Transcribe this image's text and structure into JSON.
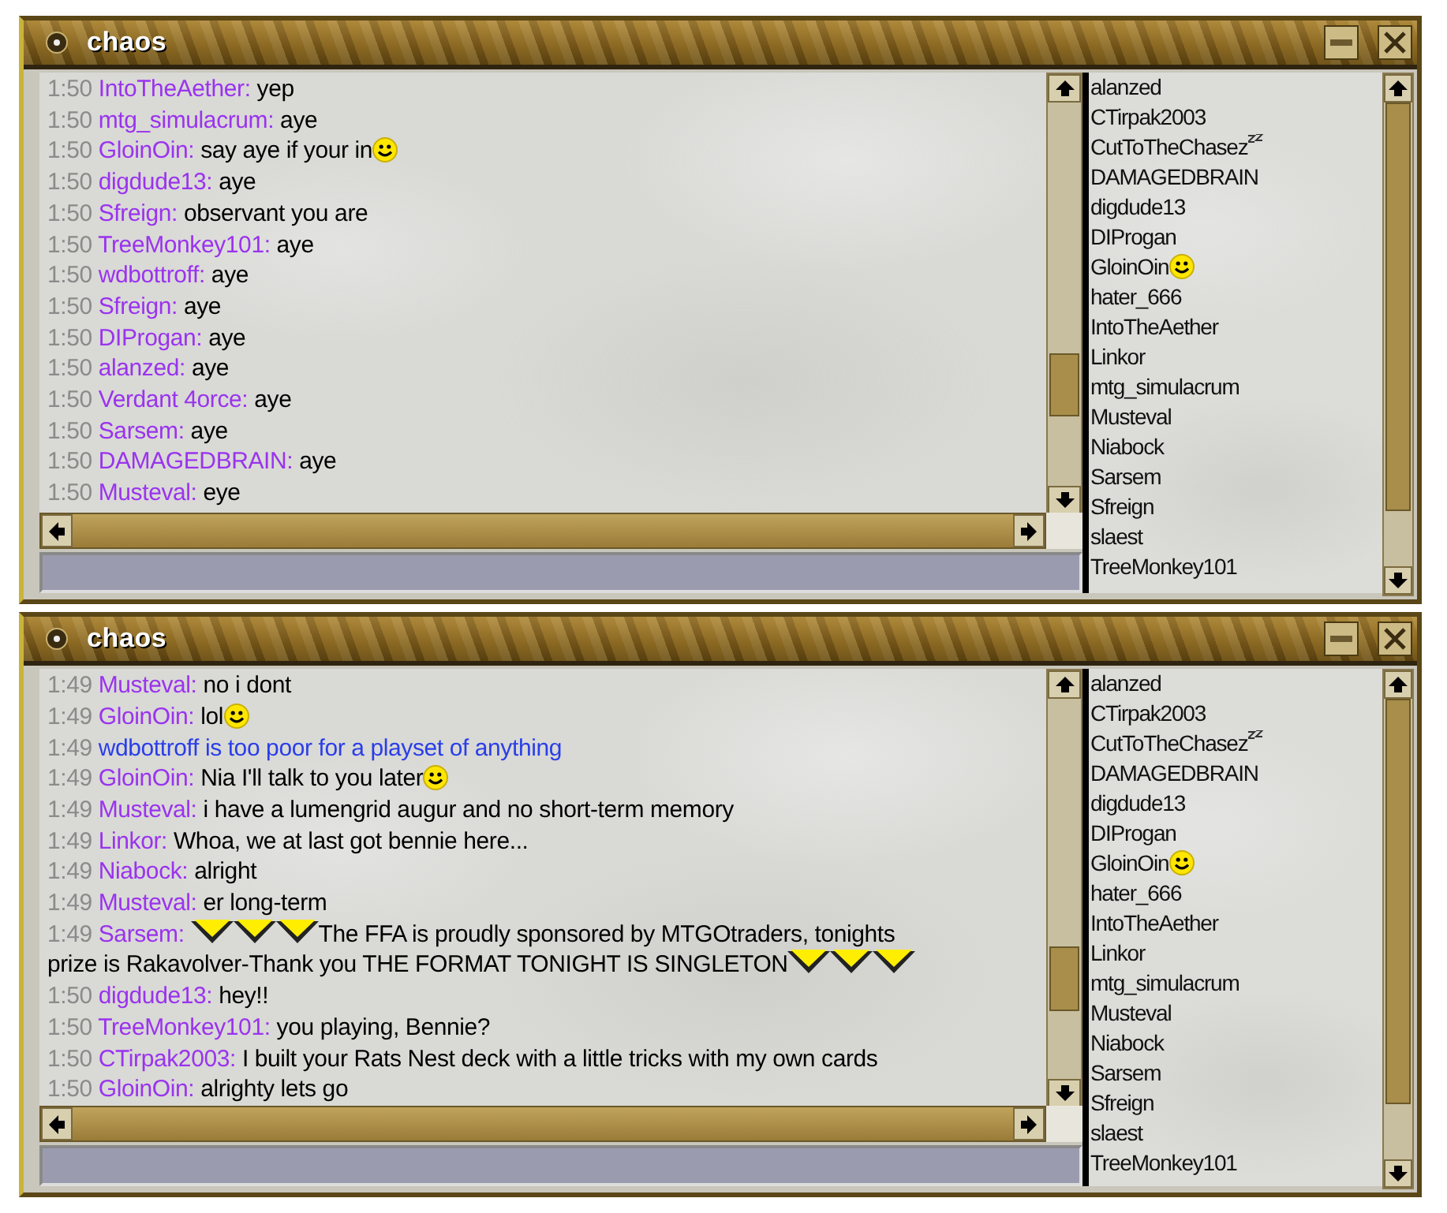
{
  "windows": [
    {
      "title": "chaos",
      "messages": [
        {
          "kind": "chat",
          "time": "1:50",
          "user": "IntoTheAether:",
          "text": "yep"
        },
        {
          "kind": "chat",
          "time": "1:50",
          "user": "mtg_simulacrum:",
          "text": "aye"
        },
        {
          "kind": "chat",
          "time": "1:50",
          "user": "GloinOin:",
          "text": "say aye if your in",
          "icons_after": [
            {
              "kind": "smiley"
            }
          ]
        },
        {
          "kind": "chat",
          "time": "1:50",
          "user": "digdude13:",
          "text": "aye"
        },
        {
          "kind": "chat",
          "time": "1:50",
          "user": "Sfreign:",
          "text": "observant you are"
        },
        {
          "kind": "chat",
          "time": "1:50",
          "user": "TreeMonkey101:",
          "text": "aye"
        },
        {
          "kind": "chat",
          "time": "1:50",
          "user": "wdbottroff:",
          "text": "aye"
        },
        {
          "kind": "chat",
          "time": "1:50",
          "user": "Sfreign:",
          "text": "aye"
        },
        {
          "kind": "chat",
          "time": "1:50",
          "user": "DIProgan:",
          "text": "aye"
        },
        {
          "kind": "chat",
          "time": "1:50",
          "user": "alanzed:",
          "text": "aye"
        },
        {
          "kind": "chat",
          "time": "1:50",
          "user": "Verdant 4orce:",
          "text": "aye"
        },
        {
          "kind": "chat",
          "time": "1:50",
          "user": "Sarsem:",
          "text": "aye"
        },
        {
          "kind": "chat",
          "time": "1:50",
          "user": "DAMAGEDBRAIN:",
          "text": "aye"
        },
        {
          "kind": "chat",
          "time": "1:50",
          "user": "Musteval:",
          "text": "eye"
        }
      ],
      "users": [
        {
          "name": "alanzed"
        },
        {
          "name": "CTirpak2003"
        },
        {
          "name": "CutToTheChasez",
          "away": true
        },
        {
          "name": "DAMAGEDBRAIN"
        },
        {
          "name": "digdude13"
        },
        {
          "name": "DIProgan"
        },
        {
          "name": "GloinOin",
          "icons": [
            {
              "kind": "smiley"
            }
          ]
        },
        {
          "name": "hater_666"
        },
        {
          "name": "IntoTheAether"
        },
        {
          "name": "Linkor"
        },
        {
          "name": "mtg_simulacrum"
        },
        {
          "name": "Musteval"
        },
        {
          "name": "Niabock"
        },
        {
          "name": "Sarsem"
        },
        {
          "name": "Sfreign"
        },
        {
          "name": "slaest"
        },
        {
          "name": "TreeMonkey101"
        }
      ]
    },
    {
      "title": "chaos",
      "messages": [
        {
          "kind": "chat",
          "time": "1:49",
          "user": "Musteval:",
          "text": "no i dont"
        },
        {
          "kind": "chat",
          "time": "1:49",
          "user": "GloinOin:",
          "text": "lol",
          "icons_after": [
            {
              "kind": "smiley"
            }
          ]
        },
        {
          "kind": "emote",
          "time": "1:49",
          "text": "wdbottroff is too poor for a playset of anything"
        },
        {
          "kind": "chat",
          "time": "1:49",
          "user": "GloinOin:",
          "text": "Nia I'll talk to you later",
          "icons_after": [
            {
              "kind": "smiley"
            }
          ]
        },
        {
          "kind": "chat",
          "time": "1:49",
          "user": "Musteval:",
          "text": "i have a lumengrid augur and no short-term memory"
        },
        {
          "kind": "chat",
          "time": "1:49",
          "user": "Linkor:",
          "text": "Whoa, we at last got bennie here..."
        },
        {
          "kind": "chat",
          "time": "1:49",
          "user": "Niabock:",
          "text": "alright"
        },
        {
          "kind": "chat",
          "time": "1:49",
          "user": "Musteval:",
          "text": "er long-term"
        },
        {
          "kind": "chat",
          "time": "1:49",
          "user": "Sarsem:",
          "text": "The FFA is proudly sponsored by MTGOtraders, tonights",
          "text_line_2": "prize is Rakavolver-Thank you THE FORMAT TONIGHT IS SINGLETON",
          "icons_before": [
            {
              "kind": "chevron"
            },
            {
              "kind": "chevron"
            },
            {
              "kind": "chevron"
            }
          ],
          "icons_after": [
            {
              "kind": "chevron"
            },
            {
              "kind": "chevron"
            },
            {
              "kind": "chevron"
            }
          ]
        },
        {
          "kind": "chat",
          "time": "1:50",
          "user": "digdude13:",
          "text": "hey!!"
        },
        {
          "kind": "chat",
          "time": "1:50",
          "user": "TreeMonkey101:",
          "text": "you playing, Bennie?"
        },
        {
          "kind": "chat",
          "time": "1:50",
          "user": "CTirpak2003:",
          "text": "I built your Rats Nest deck with a little tricks with my own cards"
        },
        {
          "kind": "chat",
          "time": "1:50",
          "user": "GloinOin:",
          "text": "alrighty lets go"
        }
      ],
      "users": [
        {
          "name": "alanzed"
        },
        {
          "name": "CTirpak2003"
        },
        {
          "name": "CutToTheChasez",
          "away": true
        },
        {
          "name": "DAMAGEDBRAIN"
        },
        {
          "name": "digdude13"
        },
        {
          "name": "DIProgan"
        },
        {
          "name": "GloinOin",
          "icons": [
            {
              "kind": "smiley"
            }
          ]
        },
        {
          "name": "hater_666"
        },
        {
          "name": "IntoTheAether"
        },
        {
          "name": "Linkor"
        },
        {
          "name": "mtg_simulacrum"
        },
        {
          "name": "Musteval"
        },
        {
          "name": "Niabock"
        },
        {
          "name": "Sarsem"
        },
        {
          "name": "Sfreign"
        },
        {
          "name": "slaest"
        },
        {
          "name": "TreeMonkey101"
        }
      ]
    }
  ]
}
